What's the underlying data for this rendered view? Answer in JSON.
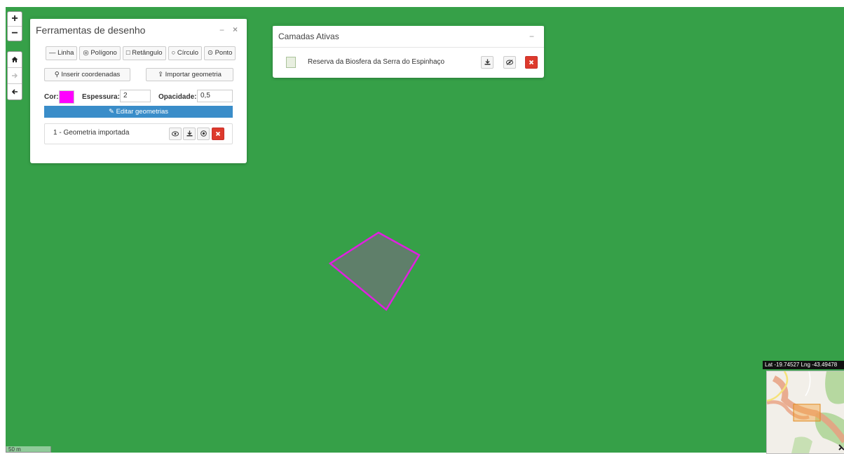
{
  "map": {
    "background": "#36a048",
    "scale_label": "50 m",
    "coords_readout": "Lat -19.74527 Lng -43.49478"
  },
  "zoom": {
    "in_label": "+",
    "out_label": "−"
  },
  "nav": {
    "home_icon": "home-icon",
    "forward_icon": "arrow-right-icon",
    "back_icon": "arrow-left-icon"
  },
  "draw_panel": {
    "title": "Ferramentas de desenho",
    "minimize": "−",
    "close": "×",
    "tools": {
      "line": "— Linha",
      "polygon": "◎ Polígono",
      "rectangle": "□ Retângulo",
      "circle": "○ Círculo",
      "point": "⊙ Ponto"
    },
    "insert_coords": "⚲ Inserir coordenadas",
    "import_geometry": "⇪ Importar geometria",
    "color_label": "Cor:",
    "color_value": "#ff00ff",
    "thickness_label": "Espessura:",
    "thickness_value": "2",
    "opacity_label": "Opacidade:",
    "opacity_value": "0,5",
    "edit_button": "✎ Editar geometrias",
    "geometries": [
      {
        "label": "1 - Geometria importada"
      }
    ]
  },
  "layers_panel": {
    "title": "Camadas Ativas",
    "minimize": "−",
    "layers": [
      {
        "name": "Reserva da Biosfera da Serra do Espinhaço"
      }
    ]
  },
  "colors": {
    "accent": "#36a048",
    "edit_blue": "#3a8dc9",
    "danger": "#dd3a2c",
    "polygon_stroke": "#e020e0",
    "polygon_fill": "#5f7f6a"
  }
}
